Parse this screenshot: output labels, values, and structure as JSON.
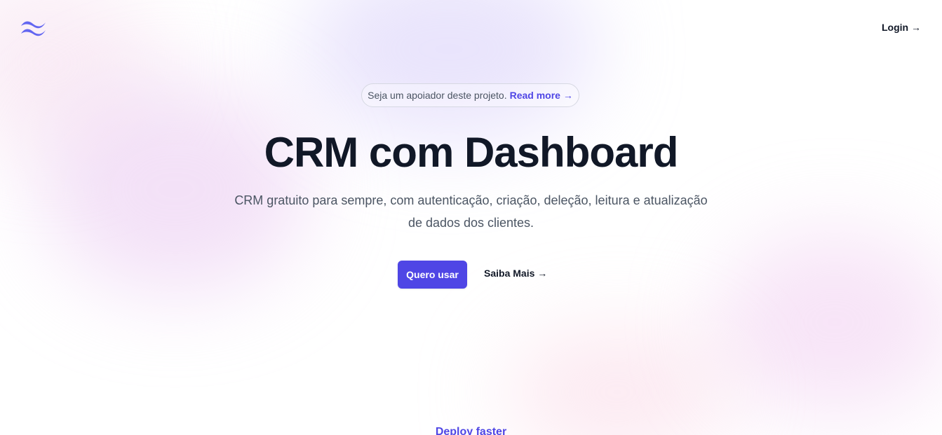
{
  "header": {
    "logo_icon": "tailwind-wave-icon",
    "login_label": "Login →"
  },
  "announcement": {
    "text": "Seja um apoiador deste projeto.",
    "link_label": "Read more →"
  },
  "hero": {
    "title": "CRM com Dashboard",
    "subtitle": "CRM gratuito para sempre, com autenticação, criação, deleção, leitura e atualização de dados dos clientes.",
    "primary_button": "Quero usar",
    "secondary_link": "Saiba Mais →"
  },
  "next_section": {
    "eyebrow": "Deploy faster"
  },
  "colors": {
    "accent": "#4f46e5",
    "heading": "#111827",
    "body_text": "#4b5563"
  }
}
